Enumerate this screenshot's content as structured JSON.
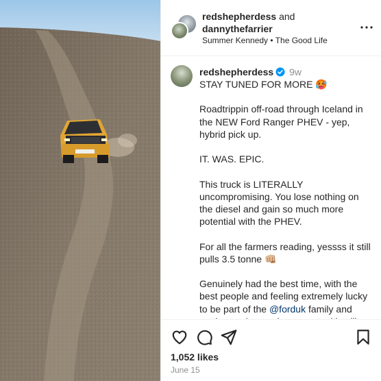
{
  "post_image": {
    "truck_plate": "VJ-UK S"
  },
  "header": {
    "user1": "redshepherdess",
    "and": "and",
    "user2": "dannythefarrier",
    "subtitle": "Summer Kennedy • The Good Life",
    "more_icon": "more-horizontal-icon"
  },
  "caption": {
    "username": "redshepherdess",
    "verified_icon": "verified-badge-icon",
    "time": "9w",
    "paragraphs": [
      "STAY TUNED FOR MORE 🥵",
      "Roadtrippin off-road through Iceland in the NEW Ford Ranger PHEV - yep, hybrid pick up.",
      "IT. WAS. EPIC.",
      "This truck is LITERALLY uncompromising. You lose nothing on the diesel and gain so much more potential with the PHEV.",
      "For all the farmers reading, yessss it still pulls 3.5 tonne 👊🏼"
    ],
    "last_before": "Genuinely had the best time, with the best people and feeling extremely lucky to be part of the ",
    "mention": "@forduk",
    "last_after": " family and getting such amazing opportunities like"
  },
  "actions": {
    "icons": [
      "heart-icon",
      "comment-icon",
      "share-icon",
      "save-icon"
    ],
    "likes": "1,052 likes",
    "date": "June 15"
  },
  "colors": {
    "mention": "#00376b",
    "verified": "#0095f6",
    "muted": "#8e8e8e",
    "dirt": "#84786a",
    "truck": "#e0a534"
  }
}
